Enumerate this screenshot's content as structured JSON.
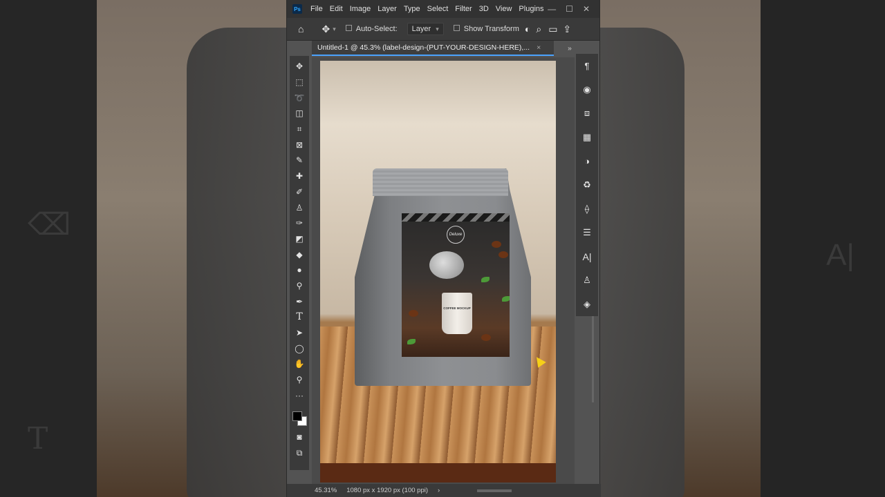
{
  "app": {
    "logo": "Ps",
    "menu": [
      "File",
      "Edit",
      "Image",
      "Layer",
      "Type",
      "Select",
      "Filter",
      "3D",
      "View",
      "Plugins"
    ],
    "window_controls": [
      "minimize",
      "maximize",
      "close"
    ]
  },
  "options_bar": {
    "auto_select_label": "Auto-Select:",
    "auto_select_target": "Layer",
    "show_transform_label": "Show Transform"
  },
  "document_tab": {
    "title": "Untitled-1 @ 45.3% (label-design-(PUT-YOUR-DESIGN-HERE),..."
  },
  "tools": [
    "move-tool-icon",
    "marquee-tool-icon",
    "lasso-tool-icon",
    "object-select-tool-icon",
    "crop-tool-icon",
    "frame-tool-icon",
    "eyedropper-tool-icon",
    "healing-brush-icon",
    "brush-tool-icon",
    "clone-stamp-icon",
    "history-brush-icon",
    "eraser-tool-icon",
    "paint-bucket-icon",
    "blur-tool-icon",
    "dodge-tool-icon",
    "pen-tool-icon",
    "type-tool-icon",
    "path-select-icon",
    "ellipse-tool-icon",
    "hand-tool-icon",
    "zoom-tool-icon",
    "edit-toolbar-icon"
  ],
  "right_panels": [
    "paragraph-icon",
    "color-icon",
    "libraries-icon",
    "swatches-icon",
    "adjustments-icon",
    "properties-icon",
    "paths-icon",
    "sliders-icon",
    "character-icon",
    "styles-icon",
    "layers-icon"
  ],
  "canvas": {
    "label_brand": "Deluxe",
    "cup_text": "COFFEE MOCKUP"
  },
  "status_bar": {
    "zoom": "45.31%",
    "doc_info": "1080 px x 1920 px (100 ppi)"
  },
  "colors": {
    "accent": "#31a8ff",
    "foreground_swatch": "#000000",
    "background_swatch": "#ffffff"
  }
}
